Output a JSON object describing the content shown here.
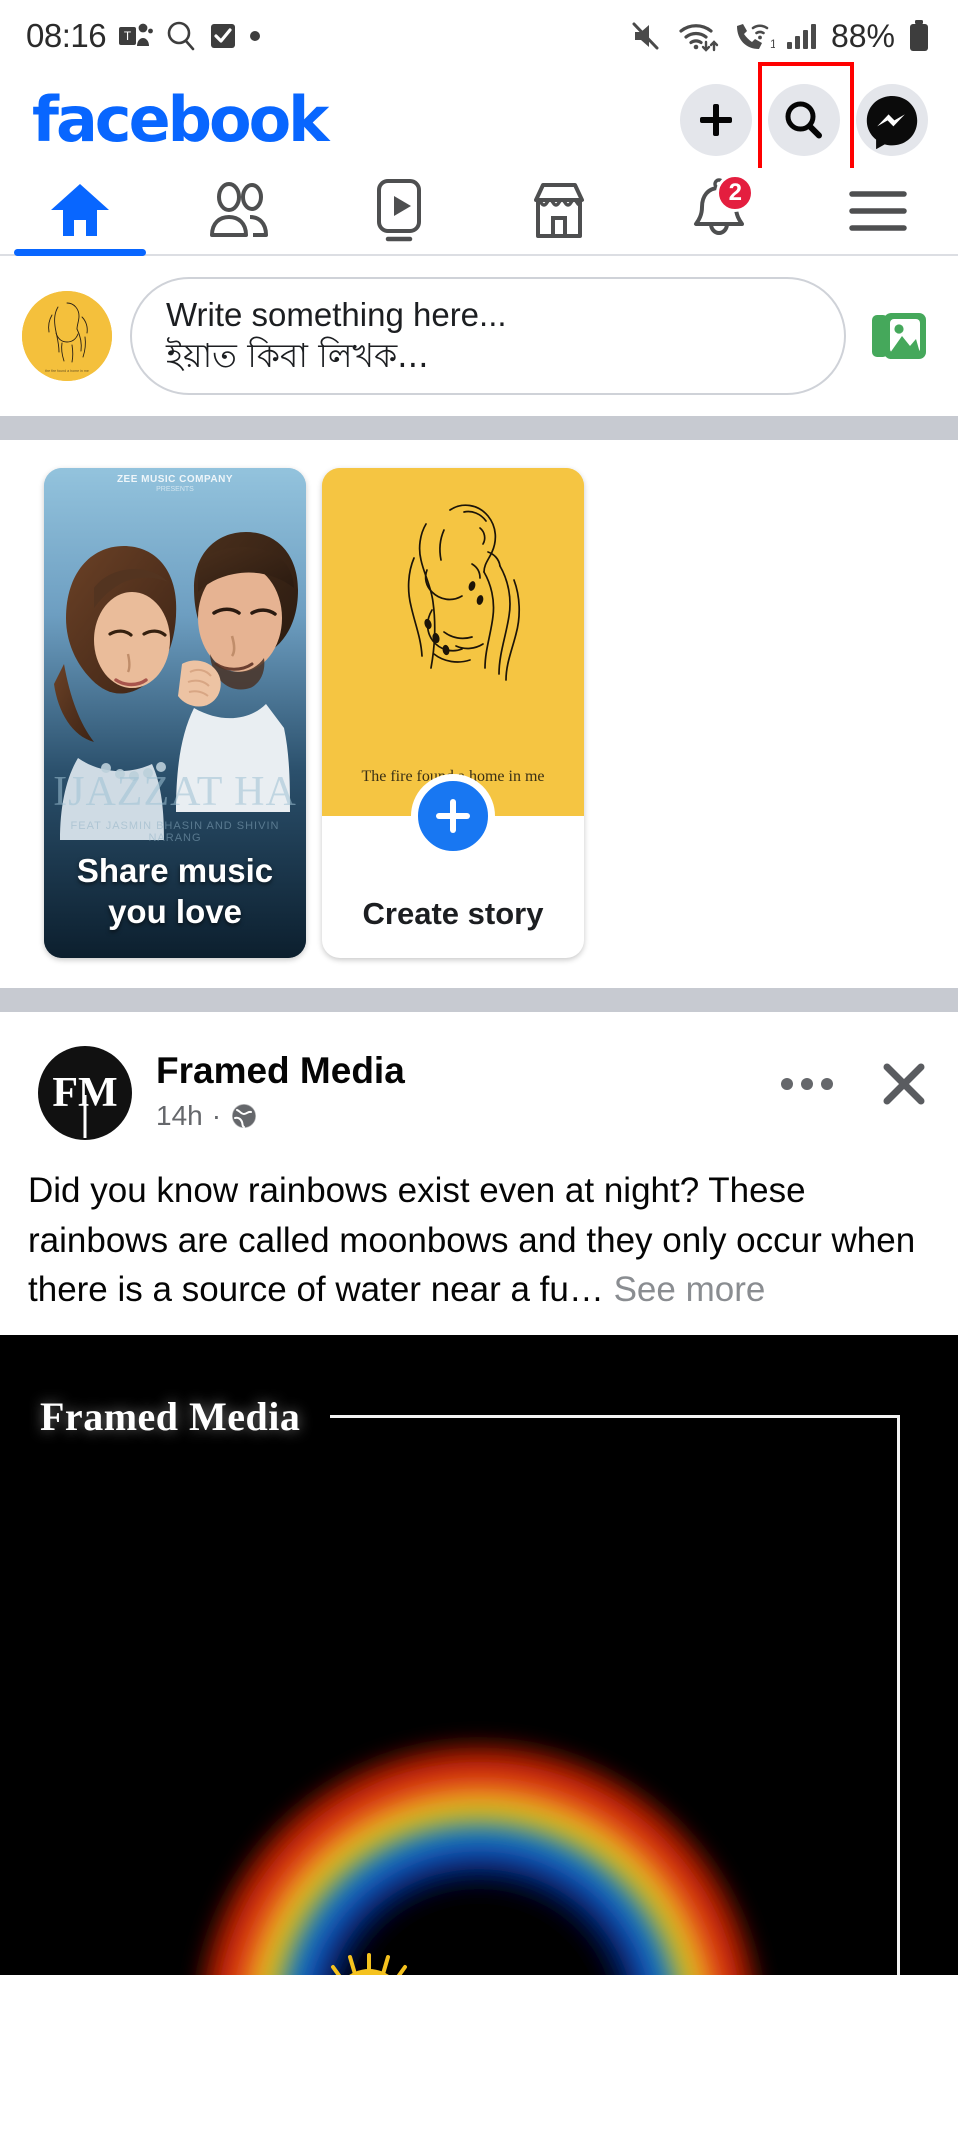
{
  "status_bar": {
    "time": "08:16",
    "battery_percent": "88%",
    "icons": [
      "teams-icon",
      "search-glass-icon",
      "checkbox-icon",
      "dot-indicator-icon",
      "mute-icon",
      "wifi-icon",
      "call-wifi-icon",
      "signal-bars-icon",
      "battery-icon"
    ],
    "sim_label": "1"
  },
  "header": {
    "logo_text": "facebook",
    "logo_color": "#0866FF",
    "buttons": [
      {
        "name": "create-button",
        "icon": "plus-icon"
      },
      {
        "name": "search-button",
        "icon": "search-icon",
        "highlighted": true
      },
      {
        "name": "messenger-button",
        "icon": "messenger-icon"
      }
    ],
    "highlight_color": "#FF0000"
  },
  "nav_tabs": [
    {
      "label": "Home",
      "icon": "home-icon",
      "active": true
    },
    {
      "label": "Friends",
      "icon": "friends-icon",
      "active": false
    },
    {
      "label": "Video",
      "icon": "video-icon",
      "active": false
    },
    {
      "label": "Marketplace",
      "icon": "marketplace-icon",
      "active": false
    },
    {
      "label": "Notifications",
      "icon": "bell-icon",
      "active": false,
      "badge": "2"
    },
    {
      "label": "Menu",
      "icon": "hamburger-menu-icon",
      "active": false
    }
  ],
  "nav_active_color": "#0866FF",
  "badge_color": "#E41E3F",
  "composer": {
    "placeholder_line1": "Write something here...",
    "placeholder_line2": "ইয়াত কিবা লিখক...",
    "photo_icon": "photo-gallery-icon",
    "photo_icon_color": "#45A85B",
    "avatar_bg": "#F4C03C"
  },
  "stories": [
    {
      "type": "music",
      "caption": "Share music you love",
      "poster_title": "IJAZZAT HA",
      "poster_credits": "FEAT JASMIN BHASIN AND SHIVIN NARANG",
      "studio_label": "ZEE MUSIC COMPANY",
      "studio_sub": "PRESENTS"
    },
    {
      "type": "create",
      "caption": "Create story",
      "quote": "The fire found a home in me",
      "plus_icon": "plus-icon",
      "accent_color": "#F5C542",
      "plus_color": "#1877F2"
    }
  ],
  "post": {
    "page_name": "Framed Media",
    "avatar_initials": "FM",
    "timestamp": "14h",
    "separator": "·",
    "audience_icon": "globe-public-icon",
    "menu_icon": "more-options-icon",
    "close_icon": "close-icon",
    "body_text": "Did you know rainbows exist even at night? These rainbows are called moonbows and they only occur when there is a source of water near a fu…",
    "see_more_label": "See more",
    "image_watermark": "Framed Media",
    "image_subject": "moonbow-rainbow-arc"
  }
}
